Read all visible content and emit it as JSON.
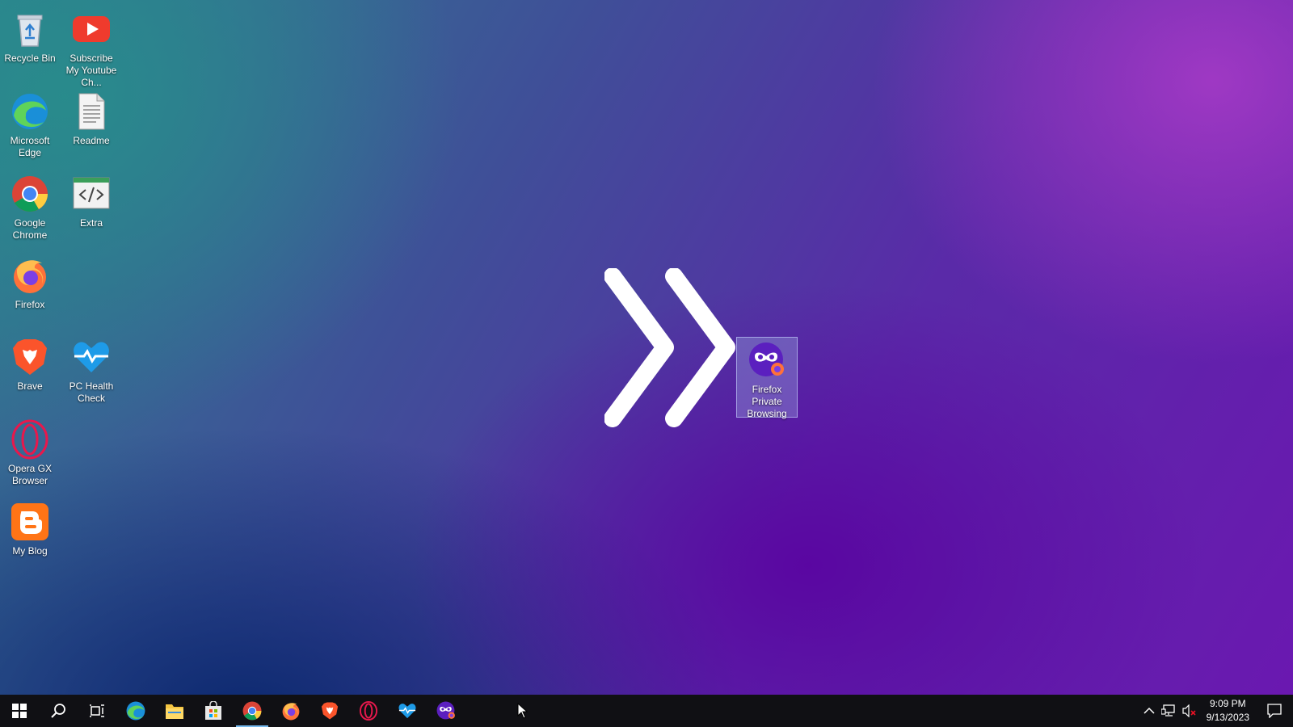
{
  "desktop": {
    "icons": [
      {
        "label": "Recycle Bin",
        "icon": "recycle-bin-icon"
      },
      {
        "label": "Subscribe My Youtube Ch...",
        "icon": "youtube-icon"
      },
      {
        "label": "Microsoft Edge",
        "icon": "edge-icon"
      },
      {
        "label": "Readme",
        "icon": "document-icon"
      },
      {
        "label": "Google Chrome",
        "icon": "chrome-icon"
      },
      {
        "label": "Extra",
        "icon": "code-file-icon"
      },
      {
        "label": "Firefox",
        "icon": "firefox-icon"
      },
      {
        "label": "Brave",
        "icon": "brave-icon"
      },
      {
        "label": "PC Health Check",
        "icon": "pc-health-check-icon"
      },
      {
        "label": "Opera GX Browser",
        "icon": "opera-gx-icon"
      },
      {
        "label": "My Blog",
        "icon": "blogger-icon"
      },
      {
        "label": "Firefox Private Browsing",
        "icon": "firefox-private-icon",
        "selected": true
      }
    ],
    "overlay_icon": "double-chevron-right-icon"
  },
  "taskbar": {
    "buttons": [
      {
        "name": "start",
        "icon": "windows-start-icon"
      },
      {
        "name": "search",
        "icon": "search-icon"
      },
      {
        "name": "task-view",
        "icon": "task-view-icon"
      },
      {
        "name": "edge",
        "icon": "edge-icon"
      },
      {
        "name": "file-explorer",
        "icon": "folder-icon"
      },
      {
        "name": "store",
        "icon": "store-icon"
      },
      {
        "name": "chrome",
        "icon": "chrome-icon",
        "active": true
      },
      {
        "name": "firefox",
        "icon": "firefox-icon"
      },
      {
        "name": "brave",
        "icon": "brave-icon"
      },
      {
        "name": "opera-gx",
        "icon": "opera-gx-icon"
      },
      {
        "name": "pc-health-check",
        "icon": "pc-health-check-icon"
      },
      {
        "name": "firefox-private",
        "icon": "firefox-private-icon"
      }
    ],
    "tray": {
      "time": "9:09 PM",
      "date": "9/13/2023",
      "icons": [
        "chevron-up-icon",
        "network-icon",
        "volume-muted-icon",
        "notification-icon"
      ]
    }
  },
  "colors": {
    "taskbar_bg": "#101014",
    "active_indicator": "#76b9ed",
    "selection": "#a0b4e6"
  }
}
